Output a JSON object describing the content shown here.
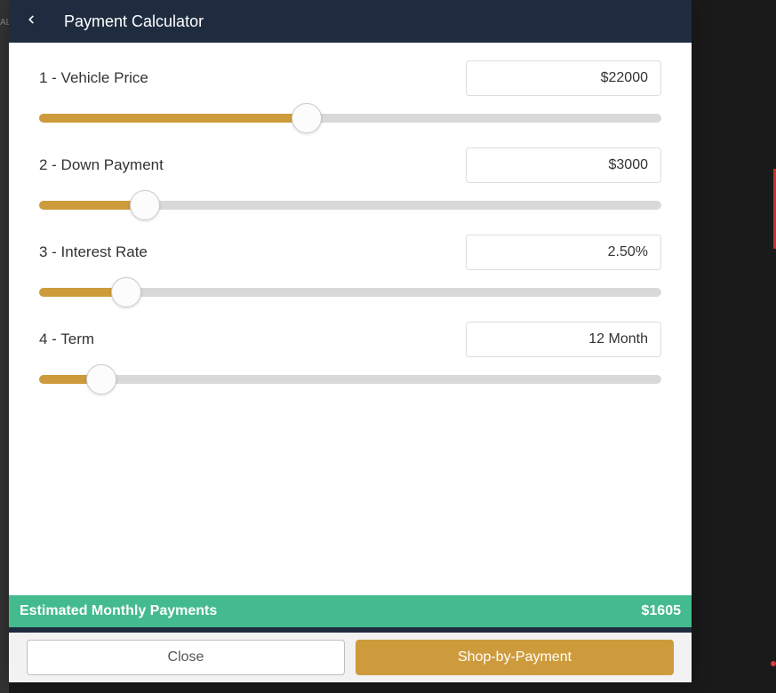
{
  "header": {
    "title": "Payment Calculator"
  },
  "fields": {
    "vehicle": {
      "label": "1 - Vehicle Price",
      "value": "$22000",
      "pct": 43
    },
    "down": {
      "label": "2 - Down Payment",
      "value": "$3000",
      "pct": 17
    },
    "interest": {
      "label": "3 - Interest Rate",
      "value": "2.50%",
      "pct": 14
    },
    "term": {
      "label": "4 - Term",
      "value": "12 Month",
      "pct": 10
    }
  },
  "summary": {
    "label": "Estimated Monthly Payments",
    "value": "$1605"
  },
  "footer": {
    "close": "Close",
    "shop": "Shop-by-Payment"
  }
}
